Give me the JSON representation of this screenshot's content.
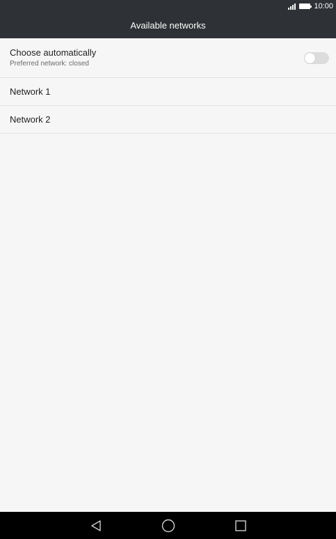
{
  "status_bar": {
    "time": "10:00",
    "signal_icon": "signal-icon",
    "battery_icon": "battery-icon"
  },
  "header": {
    "title": "Available networks"
  },
  "auto_select": {
    "label": "Choose automatically",
    "subtitle": "Preferred network: closed",
    "toggle_on": false
  },
  "networks": [
    {
      "label": "Network 1"
    },
    {
      "label": "Network 2"
    }
  ],
  "nav_bar": {
    "back_icon": "back-triangle-icon",
    "home_icon": "home-circle-icon",
    "recents_icon": "recents-square-icon"
  }
}
